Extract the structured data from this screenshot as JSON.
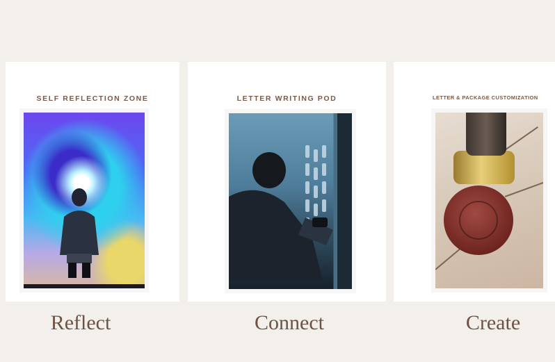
{
  "zones": [
    {
      "label": "SELF REFLECTION ZONE",
      "caption": "Reflect",
      "image": "person-facing-swirl-artwork"
    },
    {
      "label": "LETTER  WRITING POD",
      "caption": "Connect",
      "image": "person-writing-letter"
    },
    {
      "label": "LETTER & PACKAGE CUSTOMIZATION",
      "caption": "Create",
      "image": "wax-seal-stamp"
    }
  ],
  "colors": {
    "page_background": "#f3efea",
    "card_background": "#ffffff",
    "label_text": "#7a5a46",
    "caption_text": "#6b5446"
  }
}
